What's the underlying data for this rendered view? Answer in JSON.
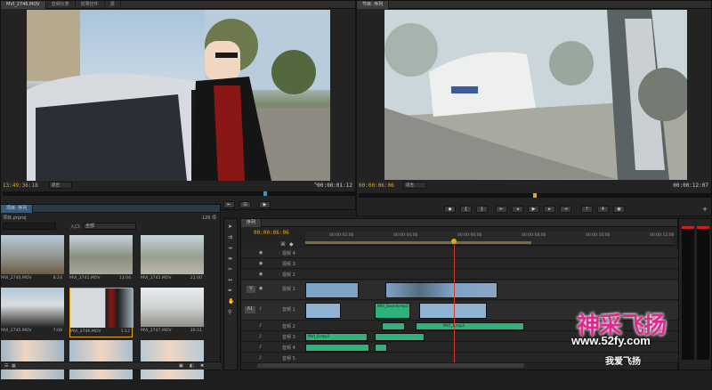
{
  "source_monitor": {
    "tabs": [
      "MVI_2746.MOV",
      "音频仪表",
      "效果控件",
      "源"
    ],
    "timecode": "13:49:36:18",
    "fit": "适合",
    "duration": "00:00:01:12"
  },
  "program_monitor": {
    "tab": "节目: 序列",
    "timecode": "00:00:06:06",
    "fit": "适合",
    "duration": "00:00:12:07"
  },
  "project_panel": {
    "tabs": [
      "项目: 序列"
    ],
    "title": "项目.prproj",
    "item_count": "126 项",
    "in_label": "入口:",
    "in_value": "全部",
    "clips": [
      {
        "name": "MVI_2740.MOV",
        "duration": "8:24"
      },
      {
        "name": "MVI_2741.MOV",
        "duration": "13:04"
      },
      {
        "name": "MVI_2742.MOV",
        "duration": "21:00"
      },
      {
        "name": "MVI_2745.MOV",
        "duration": "7:08"
      },
      {
        "name": "MVI_2746.MOV",
        "duration": "1:12"
      },
      {
        "name": "MVI_2747.MOV",
        "duration": "16:21"
      },
      {
        "name": "MVI_2748.MOV",
        "duration": ""
      },
      {
        "name": "MVI_2749.MOV",
        "duration": ""
      },
      {
        "name": "MVI_2750.MOV",
        "duration": ""
      }
    ]
  },
  "timeline": {
    "tab": "序列",
    "timecode": "00:00:06:06",
    "ruler": [
      "00:00:02:00",
      "00:00:04:00",
      "00:00:06:00",
      "00:00:08:00",
      "00:00:10:00",
      "00:00:12:00"
    ],
    "tracks": [
      {
        "id": "",
        "name": "视频 4"
      },
      {
        "id": "",
        "name": "视频 3"
      },
      {
        "id": "",
        "name": "视频 2"
      },
      {
        "id": "V",
        "name": "视频 1"
      },
      {
        "id": "A1",
        "name": "音频 1"
      },
      {
        "id": "",
        "name": "音频 2"
      },
      {
        "id": "",
        "name": "音频 3"
      },
      {
        "id": "",
        "name": "音频 4"
      },
      {
        "id": "",
        "name": "音频 5"
      }
    ],
    "clip_labels": [
      "MVI_Sound.mp3",
      "MVI_1.mp3",
      "MVI_0.mp3"
    ]
  },
  "watermark": {
    "title": "神采飞扬",
    "url": "www.52fy.com",
    "tagline": "我爱飞扬"
  },
  "colors": {
    "accent": "#e8a51a",
    "video_clip": "#7da3c9",
    "audio_clip": "#2cb27a",
    "watermark": "#e0298f"
  }
}
